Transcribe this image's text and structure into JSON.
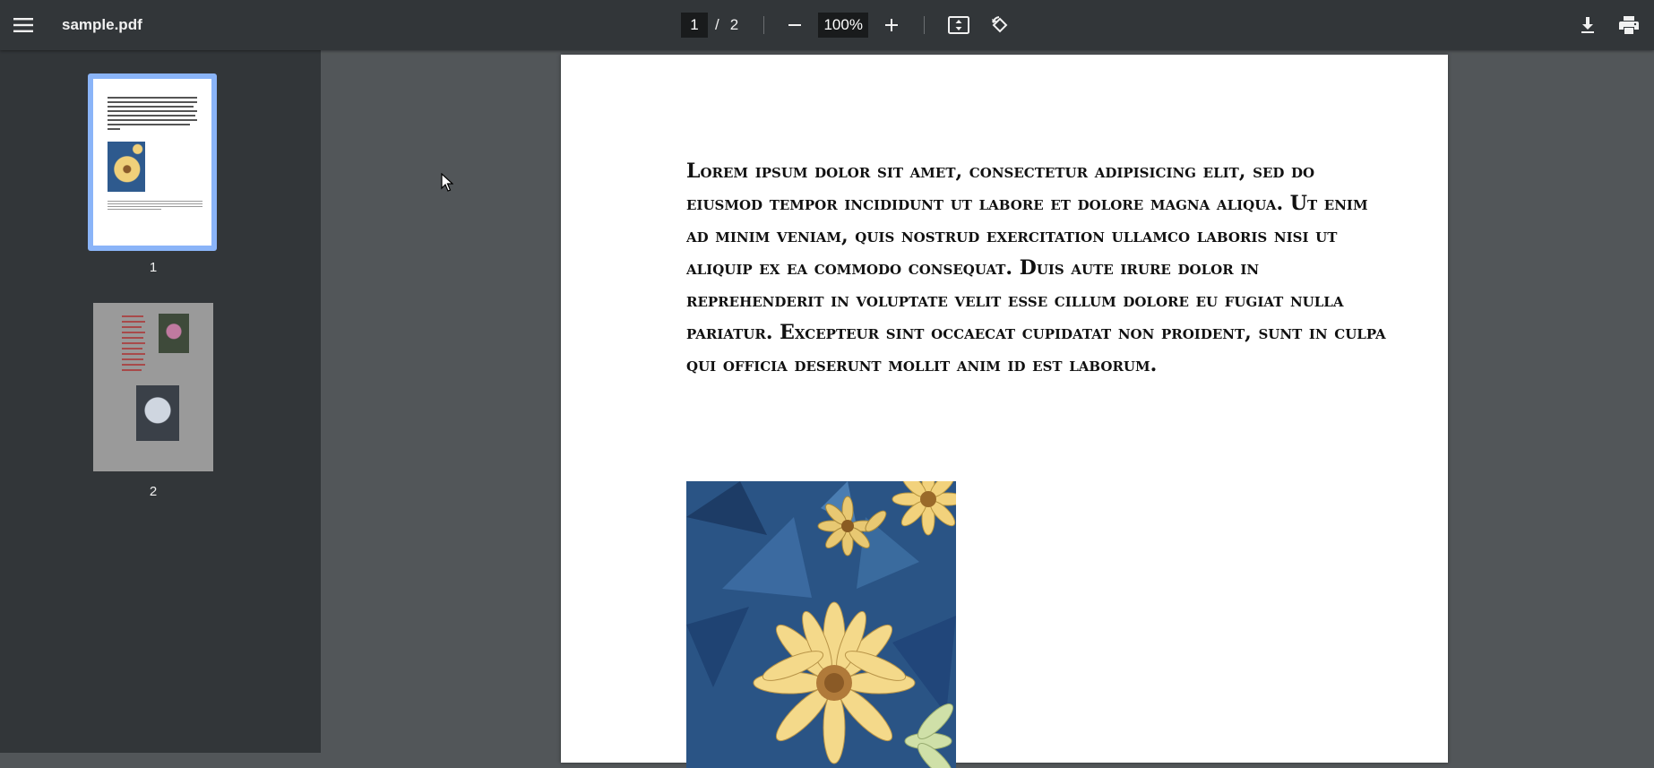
{
  "toolbar": {
    "menu_icon": "hamburger-menu-icon",
    "title": "sample.pdf",
    "current_page": "1",
    "separator": "/",
    "total_pages": "2",
    "zoom_out_icon": "minus-icon",
    "zoom_value": "100%",
    "zoom_in_icon": "plus-icon",
    "fit_icon": "fit-to-page-icon",
    "rotate_icon": "rotate-counterclockwise-icon",
    "download_icon": "download-icon",
    "print_icon": "print-icon"
  },
  "sidebar": {
    "thumbnails": [
      {
        "label": "1",
        "selected": true
      },
      {
        "label": "2",
        "selected": false
      }
    ],
    "selected_color": "#8ab4f8"
  },
  "document": {
    "paragraph": "Lorem ipsum dolor sit amet, consectetur adipisicing elit, sed do eiusmod tempor incididunt ut labore et dolore magna aliqua. Ut enim ad minim veniam, quis nostrud exercitation ullamco laboris nisi ut aliquip ex ea commodo consequat. Duis aute irure dolor in reprehenderit in voluptate velit esse cillum dolore eu fugiat nulla pariatur. Excepteur sint occaecat cupidatat non proident, sunt in culpa qui officia deserunt mollit anim id est laborum.",
    "image": "flower-image"
  },
  "colors": {
    "toolbar_bg": "#323639",
    "viewer_bg": "#525659",
    "input_bg": "#191b1c"
  }
}
